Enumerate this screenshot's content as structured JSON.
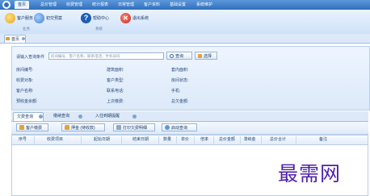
{
  "menu": {
    "items": [
      {
        "label": "首页"
      },
      {
        "label": "总价管理"
      },
      {
        "label": "收费管理"
      },
      {
        "label": "统计报表"
      },
      {
        "label": "日常管理"
      },
      {
        "label": "客户资料"
      },
      {
        "label": "基础设置"
      },
      {
        "label": "系统维护"
      }
    ]
  },
  "toolbar": {
    "buttons": [
      {
        "label": "客户服务"
      },
      {
        "label": "初交预案"
      },
      {
        "label": "帮助中心"
      },
      {
        "label": "退出系统"
      }
    ],
    "groups": [
      {
        "label": "业务"
      },
      {
        "label": "系统"
      }
    ]
  },
  "page_tab": {
    "label": "首页"
  },
  "query": {
    "label": "请输入查询条件",
    "placeholder": "房间编号、客户名称、联系电话、手机号码",
    "search_button": "查询",
    "select_button": "选择",
    "fields": [
      {
        "label": "房间编号:"
      },
      {
        "label": "建筑面积:"
      },
      {
        "label": "套内面积:"
      },
      {
        "label": "收费对象:"
      },
      {
        "label": "客户类型:"
      },
      {
        "label": "房间状态:"
      },
      {
        "label": "客户名称:"
      },
      {
        "label": "联系电话:"
      },
      {
        "label": "手机:"
      },
      {
        "label": "预收金余额:"
      },
      {
        "label": "上次缴费:"
      },
      {
        "label": "总欠金额:"
      }
    ]
  },
  "lower_tabs": [
    {
      "label": "欠费查询"
    },
    {
      "label": "缴纳查询"
    },
    {
      "label": "入住到期提醒"
    }
  ],
  "actions": [
    {
      "label": "客户缴费"
    },
    {
      "label": "押金 (待收款)"
    },
    {
      "label": "打印欠费明细"
    },
    {
      "label": "启动查询"
    }
  ],
  "grid": {
    "columns": [
      "序号",
      "收费项目",
      "起始日期",
      "结束日期",
      "数量",
      "单价",
      "倍率",
      "总价金额",
      "滞纳金",
      "总价合计",
      "备注"
    ]
  },
  "watermark": "最需网",
  "colors": {
    "menu": "#2f6fbf",
    "accent": "#5b97d9",
    "watermark": "#4d1fa8"
  }
}
